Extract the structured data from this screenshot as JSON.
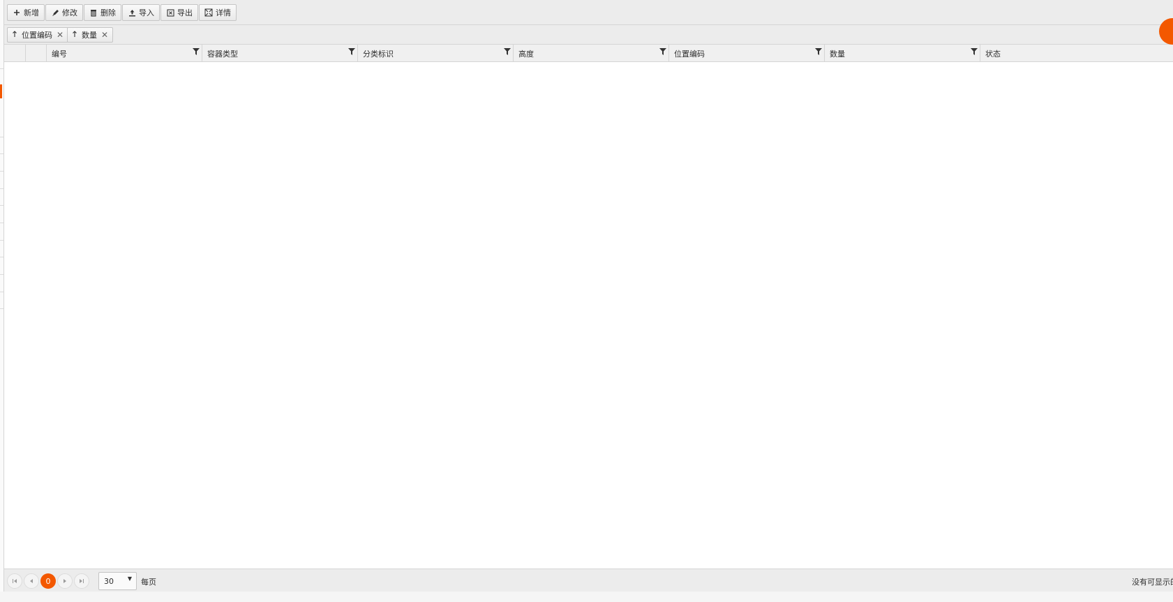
{
  "toolbar": {
    "buttons": [
      {
        "label": "新增",
        "icon": "plus-icon"
      },
      {
        "label": "修改",
        "icon": "pencil-icon"
      },
      {
        "label": "删除",
        "icon": "trash-icon"
      },
      {
        "label": "导入",
        "icon": "upload-icon"
      },
      {
        "label": "导出",
        "icon": "excel-icon"
      },
      {
        "label": "详情",
        "icon": "details-icon"
      }
    ]
  },
  "group": {
    "chips": [
      {
        "label": "位置编码"
      },
      {
        "label": "数量"
      }
    ]
  },
  "table": {
    "columns": [
      "编号",
      "容器类型",
      "分类标识",
      "高度",
      "位置编码",
      "数量",
      "状态"
    ]
  },
  "pager": {
    "current_page": "0",
    "page_size": "30",
    "per_page_label": "每页",
    "info": "没有可显示的记录"
  },
  "colors": {
    "accent": "#f35800",
    "toolbar_bg": "#ececec",
    "border": "#d5d5d5"
  }
}
